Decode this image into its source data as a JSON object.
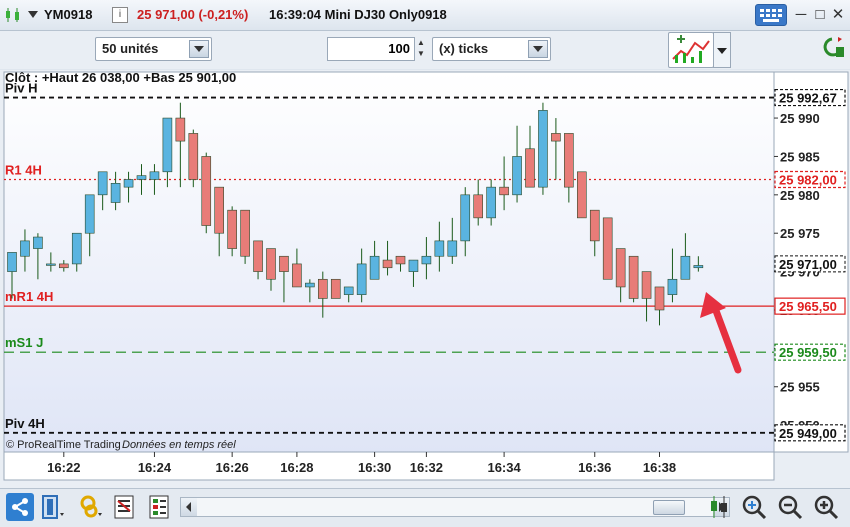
{
  "header": {
    "symbol": "YM0918",
    "price_change": "25 971,00 (-0,21%)",
    "time_title": "16:39:04 Mini DJ30 Only0918",
    "info_icon": "i"
  },
  "toolbar": {
    "units_label": "50 unités",
    "quantity_value": "100",
    "ticks_label": "(x) ticks"
  },
  "chart_data": {
    "type": "candlestick",
    "ylim": [
      25946.5,
      25996
    ],
    "y_ticks": [
      25950,
      25955,
      25960,
      25965,
      25970,
      25975,
      25980,
      25985,
      25990
    ],
    "y_tick_labels": [
      "25 950",
      "25 955",
      "25 960",
      "25 965",
      "25 970",
      "25 975",
      "25 980",
      "25 985",
      "25 990"
    ],
    "x_ticks": [
      {
        "label": "16:22",
        "index": 4
      },
      {
        "label": "16:24",
        "index": 11
      },
      {
        "label": "16:26",
        "index": 17
      },
      {
        "label": "16:28",
        "index": 22
      },
      {
        "label": "16:30",
        "index": 28
      },
      {
        "label": "16:32",
        "index": 32
      },
      {
        "label": "16:34",
        "index": 38
      },
      {
        "label": "16:36",
        "index": 45
      },
      {
        "label": "16:38",
        "index": 50
      }
    ],
    "candles": [
      {
        "o": 25970,
        "h": 25971.5,
        "l": 25966.5,
        "c": 25972.5
      },
      {
        "o": 25972,
        "h": 25975.5,
        "l": 25970,
        "c": 25974
      },
      {
        "o": 25973,
        "h": 25975,
        "l": 25969,
        "c": 25974.5
      },
      {
        "o": 25971,
        "h": 25972.5,
        "l": 25970,
        "c": 25971
      },
      {
        "o": 25971,
        "h": 25971.5,
        "l": 25970,
        "c": 25970.5
      },
      {
        "o": 25971,
        "h": 25975,
        "l": 25970,
        "c": 25975
      },
      {
        "o": 25975,
        "h": 25979,
        "l": 25972,
        "c": 25980
      },
      {
        "o": 25980,
        "h": 25982,
        "l": 25978,
        "c": 25983
      },
      {
        "o": 25979,
        "h": 25983,
        "l": 25978,
        "c": 25981.5
      },
      {
        "o": 25981,
        "h": 25983,
        "l": 25979,
        "c": 25982
      },
      {
        "o": 25982,
        "h": 25984,
        "l": 25980,
        "c": 25982.5
      },
      {
        "o": 25982,
        "h": 25984,
        "l": 25980,
        "c": 25983
      },
      {
        "o": 25983,
        "h": 25985,
        "l": 25981,
        "c": 25990
      },
      {
        "o": 25990,
        "h": 25992,
        "l": 25981,
        "c": 25987
      },
      {
        "o": 25988,
        "h": 25988.5,
        "l": 25981,
        "c": 25982
      },
      {
        "o": 25985,
        "h": 25985.5,
        "l": 25975,
        "c": 25976
      },
      {
        "o": 25981,
        "h": 25981,
        "l": 25972,
        "c": 25975
      },
      {
        "o": 25978,
        "h": 25978.5,
        "l": 25972,
        "c": 25973
      },
      {
        "o": 25978,
        "h": 25978,
        "l": 25971,
        "c": 25972
      },
      {
        "o": 25974,
        "h": 25974,
        "l": 25969,
        "c": 25970
      },
      {
        "o": 25973,
        "h": 25973,
        "l": 25967.5,
        "c": 25969
      },
      {
        "o": 25972,
        "h": 25972,
        "l": 25966,
        "c": 25970
      },
      {
        "o": 25971,
        "h": 25973,
        "l": 25969,
        "c": 25968
      },
      {
        "o": 25968,
        "h": 25969,
        "l": 25966,
        "c": 25968.5
      },
      {
        "o": 25969,
        "h": 25970,
        "l": 25964,
        "c": 25966.5
      },
      {
        "o": 25969,
        "h": 25969,
        "l": 25966.5,
        "c": 25966.5
      },
      {
        "o": 25967,
        "h": 25968,
        "l": 25966,
        "c": 25968
      },
      {
        "o": 25967,
        "h": 25973,
        "l": 25966,
        "c": 25971
      },
      {
        "o": 25969,
        "h": 25974,
        "l": 25969,
        "c": 25972
      },
      {
        "o": 25971.5,
        "h": 25974,
        "l": 25969.5,
        "c": 25970.5
      },
      {
        "o": 25972,
        "h": 25972,
        "l": 25970,
        "c": 25971
      },
      {
        "o": 25970,
        "h": 25970,
        "l": 25968,
        "c": 25971.5
      },
      {
        "o": 25971,
        "h": 25974.5,
        "l": 25969,
        "c": 25972
      },
      {
        "o": 25972,
        "h": 25976.5,
        "l": 25970,
        "c": 25974
      },
      {
        "o": 25972,
        "h": 25977,
        "l": 25971,
        "c": 25974
      },
      {
        "o": 25974,
        "h": 25981,
        "l": 25972,
        "c": 25980
      },
      {
        "o": 25980,
        "h": 25982,
        "l": 25976,
        "c": 25977
      },
      {
        "o": 25977,
        "h": 25982,
        "l": 25976,
        "c": 25981
      },
      {
        "o": 25981,
        "h": 25985,
        "l": 25978,
        "c": 25980
      },
      {
        "o": 25980,
        "h": 25989,
        "l": 25979,
        "c": 25985
      },
      {
        "o": 25986,
        "h": 25989,
        "l": 25984,
        "c": 25981
      },
      {
        "o": 25981,
        "h": 25992,
        "l": 25980,
        "c": 25991
      },
      {
        "o": 25988,
        "h": 25990,
        "l": 25982,
        "c": 25987
      },
      {
        "o": 25988,
        "h": 25988,
        "l": 25979,
        "c": 25981
      },
      {
        "o": 25983,
        "h": 25983,
        "l": 25977,
        "c": 25977
      },
      {
        "o": 25978,
        "h": 25978,
        "l": 25972,
        "c": 25974
      },
      {
        "o": 25977,
        "h": 25977,
        "l": 25969,
        "c": 25969
      },
      {
        "o": 25973,
        "h": 25973,
        "l": 25966,
        "c": 25968
      },
      {
        "o": 25972,
        "h": 25972,
        "l": 25966,
        "c": 25966.5
      },
      {
        "o": 25970,
        "h": 25970,
        "l": 25963.5,
        "c": 25966.5
      },
      {
        "o": 25968,
        "h": 25968,
        "l": 25963,
        "c": 25965
      },
      {
        "o": 25967,
        "h": 25973,
        "l": 25966,
        "c": 25969
      },
      {
        "o": 25969,
        "h": 25975,
        "l": 25969,
        "c": 25972
      },
      {
        "o": 25970.5,
        "h": 25972,
        "l": 25970,
        "c": 25970.8
      }
    ],
    "levels": [
      {
        "name": "Piv H",
        "value": 25992.67,
        "label": "25 992,67",
        "style": "dash-black"
      },
      {
        "name": "R1 4H",
        "value": 25982.0,
        "label": "25 982,00",
        "style": "dot-red"
      },
      {
        "name": "mR1 4H",
        "value": 25965.5,
        "label": "25 965,50",
        "style": "solid-red"
      },
      {
        "name": "mS1 J",
        "value": 25959.5,
        "label": "25 959,50",
        "style": "dash-green"
      },
      {
        "name": "Piv 4H",
        "value": 25949.0,
        "label": "25 949,00",
        "style": "dash-black"
      }
    ],
    "current_price": {
      "value": 25971.0,
      "label": "25 971,00"
    },
    "overlay_text": "Clôt : +Haut 26 038,00 +Bas 25 901,00",
    "attribution": "© ProRealTime Trading",
    "attribution_rt": "Données en temps réel"
  },
  "colors": {
    "up_candle": "#5ab4e0",
    "down_candle": "#e87c78",
    "red": "#e02020",
    "green": "#1b8a1b",
    "arrow": "#e63040"
  }
}
